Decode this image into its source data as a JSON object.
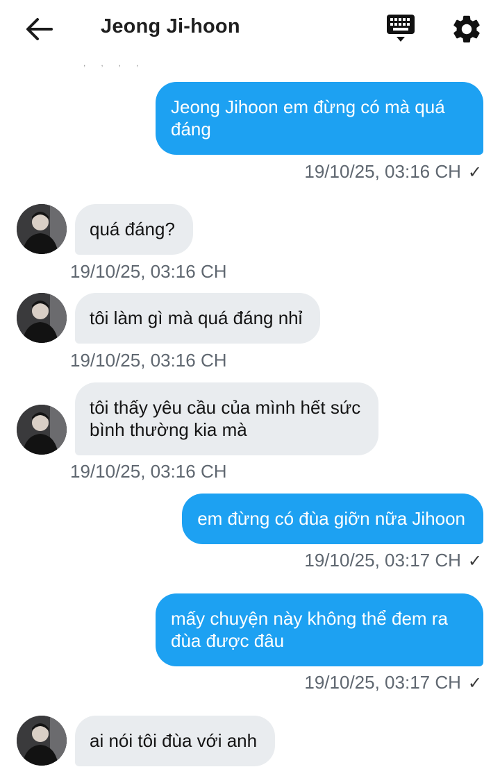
{
  "header": {
    "title": "Jeong Ji-hoon",
    "back_icon": "arrow-left-icon",
    "keyboard_icon": "keyboard-icon",
    "settings_icon": "gear-icon"
  },
  "colors": {
    "outgoing_bubble": "#1da1f2",
    "incoming_bubble": "#e9ecef",
    "timestamp": "#5f6770"
  },
  "messages": [
    {
      "direction": "outgoing",
      "text": "Jeong Jihoon em đừng có mà quá\nđáng",
      "time": "19/10/25, 03:16 CH",
      "status": "✓"
    },
    {
      "direction": "incoming",
      "text": "quá đáng?",
      "time": "19/10/25, 03:16 CH"
    },
    {
      "direction": "incoming",
      "text": "tôi làm gì mà quá đáng nhỉ",
      "time": "19/10/25, 03:16 CH"
    },
    {
      "direction": "incoming",
      "text": "tôi thấy yêu cầu của mình hết sức\nbình thường kia mà",
      "time": "19/10/25, 03:16 CH"
    },
    {
      "direction": "outgoing",
      "text": "em đừng có đùa giỡn nữa Jihoon",
      "time": "19/10/25, 03:17 CH",
      "status": "✓"
    },
    {
      "direction": "outgoing",
      "text": "mấy chuyện này không thể đem ra\nđùa được đâu",
      "time": "19/10/25, 03:17 CH",
      "status": "✓"
    },
    {
      "direction": "incoming",
      "text": "ai nói tôi đùa với anh",
      "time": ""
    }
  ]
}
